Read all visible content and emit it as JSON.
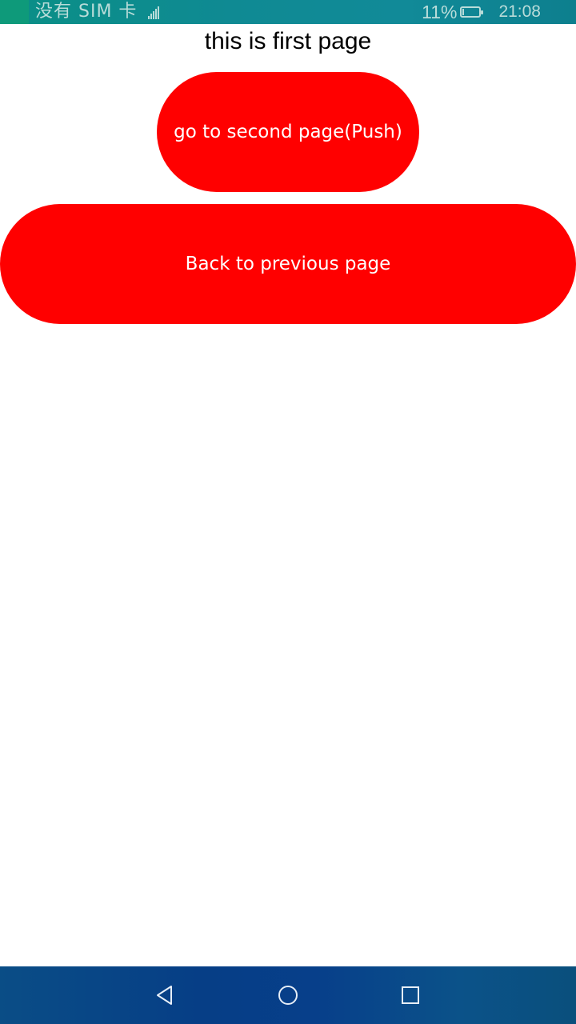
{
  "status_bar": {
    "carrier": "没有 SIM 卡",
    "battery_percent_text": "11%",
    "battery_level": 0.11,
    "time": "21:08",
    "icons": {
      "signal": "signal-icon",
      "battery": "battery-icon"
    }
  },
  "main": {
    "title": "this is first page",
    "push_button_label": "go to second page(Push)",
    "back_button_label": "Back to previous page",
    "button_color": "#ff0000"
  },
  "nav_bar": {
    "icons": {
      "back": "back-triangle-icon",
      "home": "home-circle-icon",
      "recent": "recent-square-icon"
    }
  }
}
